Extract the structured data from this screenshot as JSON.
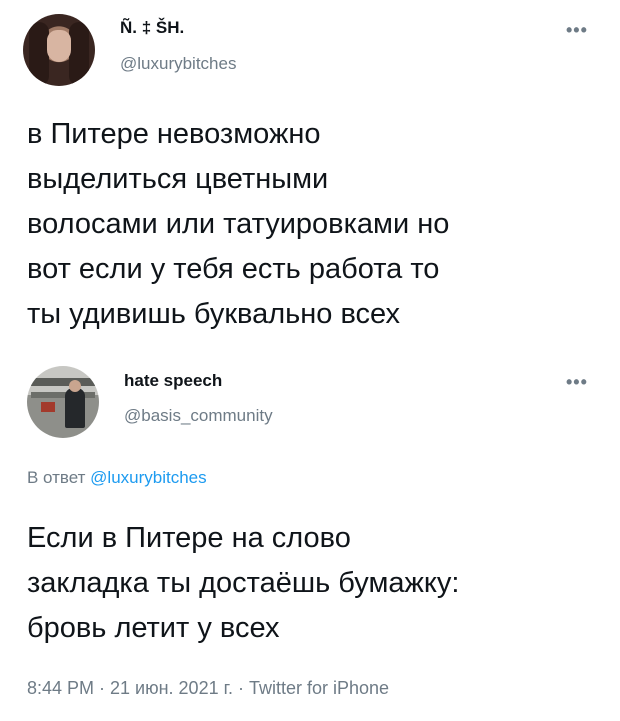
{
  "original_tweet": {
    "display_name": "Ñ. ‡ ŠH.",
    "handle": "@luxurybitches",
    "more_icon": "•••",
    "text_lines": [
      "в Питере невозможно",
      "выделиться цветными",
      "волосами или татуировками но",
      "вот если у тебя есть работа то",
      "ты удивишь буквально всех"
    ]
  },
  "reply_tweet": {
    "display_name": "hate speech",
    "handle": "@basis_community",
    "more_icon": "•••",
    "reply_prefix": "В ответ ",
    "reply_to": "@luxurybitches",
    "text_lines": [
      "Если в Питере на слово",
      "закладка ты достаёшь бумажку:",
      "бровь летит у всех"
    ],
    "meta": "8:44 PM · 21 июн. 2021 г. · Twitter for iPhone"
  },
  "colors": {
    "text": "#0f1419",
    "secondary": "#6e7b86",
    "link": "#1d9bf0",
    "background": "#ffffff"
  }
}
